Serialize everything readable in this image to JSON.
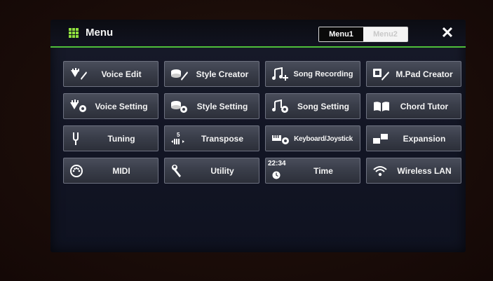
{
  "header": {
    "title": "Menu",
    "tabs": [
      {
        "label": "Menu1",
        "active": true
      },
      {
        "label": "Menu2",
        "active": false
      }
    ],
    "close_label": "✕"
  },
  "colors": {
    "accent": "#4fbf3a",
    "button_bg": "#3a3e4a",
    "screen_bg": "#141727"
  },
  "buttons": [
    {
      "label": "Voice Edit",
      "icon": "voice-edit-icon"
    },
    {
      "label": "Style Creator",
      "icon": "style-creator-icon"
    },
    {
      "label": "Song Recording",
      "icon": "song-recording-icon"
    },
    {
      "label": "M.Pad Creator",
      "icon": "mpad-creator-icon"
    },
    {
      "label": "Voice Setting",
      "icon": "voice-setting-icon"
    },
    {
      "label": "Style Setting",
      "icon": "style-setting-icon"
    },
    {
      "label": "Song Setting",
      "icon": "song-setting-icon"
    },
    {
      "label": "Chord Tutor",
      "icon": "book-icon"
    },
    {
      "label": "Tuning",
      "icon": "tuning-fork-icon"
    },
    {
      "label": "Transpose",
      "icon": "transpose-icon",
      "icon_text": "5"
    },
    {
      "label": "Keyboard/Joystick",
      "icon": "keyboard-joystick-icon"
    },
    {
      "label": "Expansion",
      "icon": "expansion-icon"
    },
    {
      "label": "MIDI",
      "icon": "midi-icon"
    },
    {
      "label": "Utility",
      "icon": "wrench-icon"
    },
    {
      "label": "Time",
      "icon": "clock-icon",
      "icon_text": "22:34"
    },
    {
      "label": "Wireless LAN",
      "icon": "wifi-icon"
    }
  ]
}
